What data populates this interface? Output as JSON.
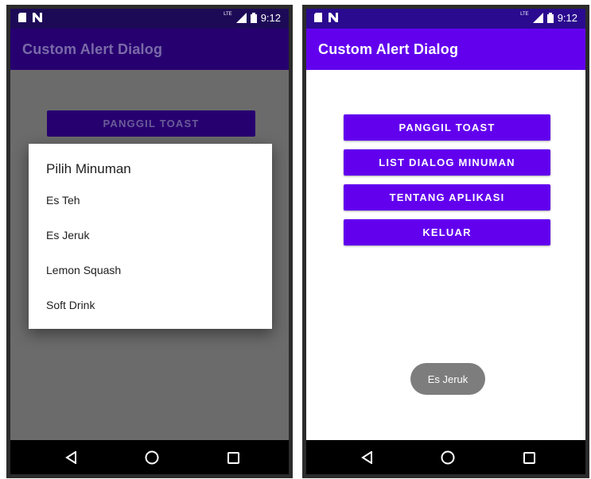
{
  "status_bar": {
    "time": "9:12",
    "lte": "LTE",
    "icons": [
      "sd-card-icon",
      "notification-n-icon",
      "signal-icon",
      "battery-icon"
    ]
  },
  "app_bar": {
    "title": "Custom Alert Dialog"
  },
  "buttons": {
    "toast": "PANGGIL TOAST",
    "list_dialog": "LIST DIALOG MINUMAN",
    "about": "TENTANG APLIKASI",
    "exit": "KELUAR"
  },
  "dialog": {
    "title": "Pilih Minuman",
    "items": [
      "Es Teh",
      "Es Jeruk",
      "Lemon Squash",
      "Soft Drink"
    ]
  },
  "toast": {
    "text": "Es Jeruk"
  },
  "nav": {
    "icons": [
      "back-icon",
      "home-icon",
      "recents-icon"
    ]
  },
  "colors": {
    "primary": "#6200ee",
    "primary_dark": "#3700b3",
    "scrim": "#6b6b6b",
    "toast_bg": "#7d7d7d"
  }
}
